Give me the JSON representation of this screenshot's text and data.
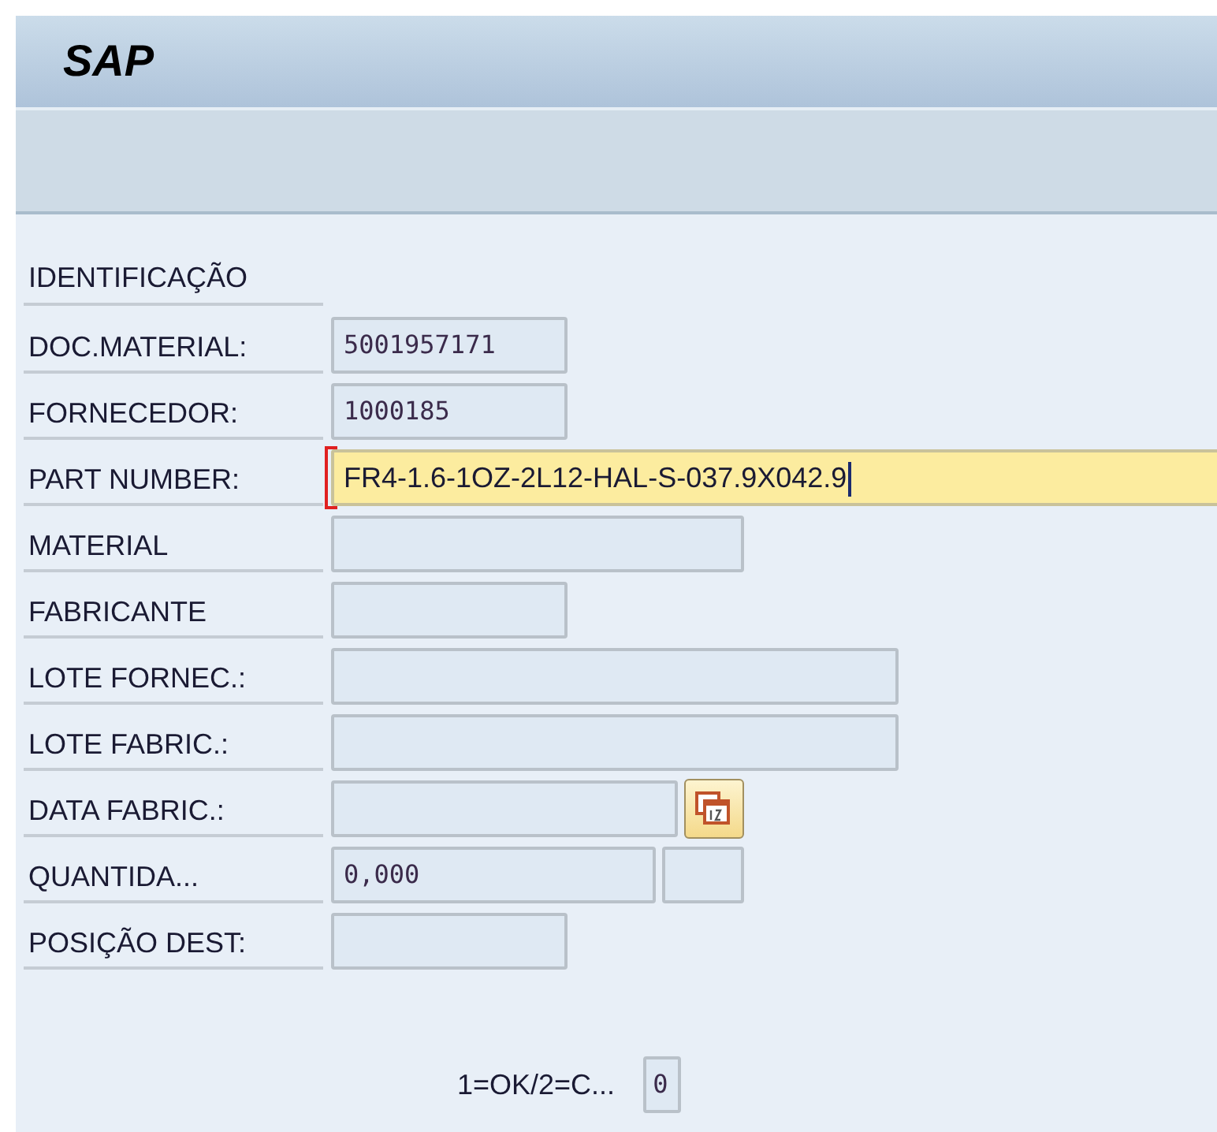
{
  "window": {
    "title": "SAP"
  },
  "section": {
    "title": "IDENTIFICAÇÃO"
  },
  "fields": [
    {
      "label": "DOC.MATERIAL:",
      "value": "5001957171",
      "kind": "numeric",
      "focused": false
    },
    {
      "label": "FORNECEDOR:",
      "value": "1000185",
      "kind": "numeric",
      "focused": false
    },
    {
      "label": "PART NUMBER:",
      "value": "FR4-1.6-1OZ-2L12-HAL-S-037.9X042.9",
      "kind": "text",
      "focused": true
    },
    {
      "label": "MATERIAL",
      "kind": "text",
      "focused": false
    },
    {
      "label": "FABRICANTE",
      "kind": "text",
      "focused": false
    },
    {
      "label": "LOTE FORNEC.:",
      "kind": "text",
      "focused": false
    },
    {
      "label": "LOTE FABRIC.:",
      "kind": "text",
      "focused": false
    },
    {
      "label": "DATA FABRIC.:",
      "kind": "date",
      "focused": false
    },
    {
      "label": "QUANTIDA...",
      "value": "0,000",
      "kind": "quantity",
      "focused": false
    },
    {
      "label": "POSIÇÃO DEST:",
      "kind": "text",
      "focused": false
    }
  ],
  "confirm": {
    "label": "1=OK/2=C...",
    "value": "0"
  }
}
